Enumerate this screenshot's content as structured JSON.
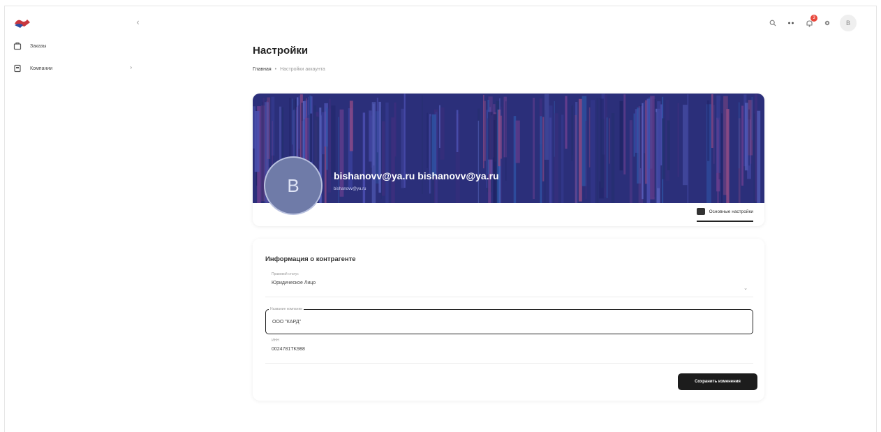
{
  "sidebar": {
    "collapse_glyph": "‹",
    "items": [
      {
        "label": "Заказы",
        "icon": "orders-icon"
      },
      {
        "label": "Компании",
        "icon": "companies-icon",
        "chevron": "›"
      }
    ]
  },
  "topbar": {
    "badge": "3",
    "avatar_initial": "B"
  },
  "page": {
    "title": "Настройки",
    "breadcrumb": {
      "home": "Главная",
      "separator": "•",
      "current": "Настройки аккаунта"
    }
  },
  "profile": {
    "initial": "B",
    "name": "bishanovv@ya.ru bishanovv@ya.ru",
    "email": "bishanovv@ya.ru",
    "tab_label": "Основные настройки"
  },
  "form": {
    "title": "Информация о контрагенте",
    "legal_status_label": "Правовой статус",
    "legal_status_value": "Юридическое Лицо",
    "company_label": "Название компании",
    "company_value": "ООО \"КАРД\"",
    "inn_label": "ИНН",
    "inn_value": "0024781TK988",
    "save_label": "Сохранить изменения"
  },
  "colors": {
    "cover": "#2b2f7a",
    "accent_dark": "#1c1c1c",
    "badge": "#e8473b"
  }
}
